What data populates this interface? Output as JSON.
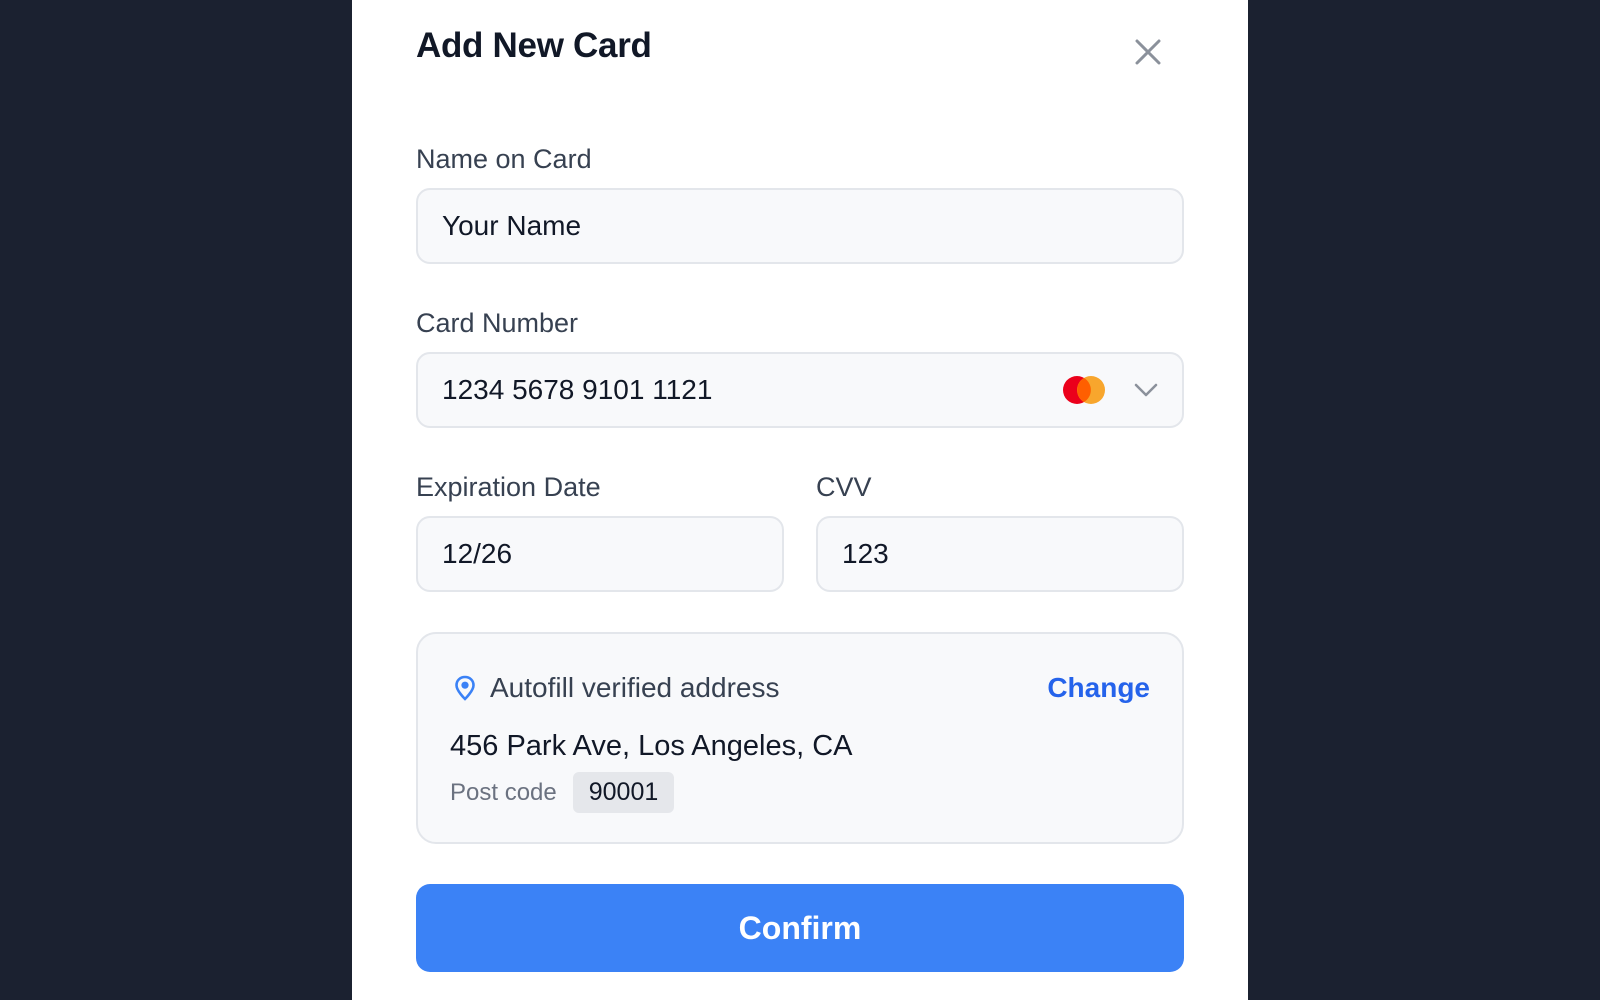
{
  "modal": {
    "title": "Add New Card",
    "close_icon": "close-icon"
  },
  "form": {
    "name": {
      "label": "Name on Card",
      "value": "Your Name"
    },
    "card_number": {
      "label": "Card Number",
      "value": "1234 5678 9101 1121",
      "brand_icon": "mastercard-icon",
      "dropdown_icon": "chevron-down-icon"
    },
    "expiration": {
      "label": "Expiration Date",
      "value": "12/26"
    },
    "cvv": {
      "label": "CVV",
      "value": "123"
    }
  },
  "address": {
    "icon": "location-pin-icon",
    "heading": "Autofill verified address",
    "change_label": "Change",
    "line": "456 Park Ave, Los Angeles, CA",
    "postcode_label": "Post code",
    "postcode": "90001"
  },
  "confirm_label": "Confirm",
  "colors": {
    "backdrop": "#1b2130",
    "accent": "#3b82f6",
    "link": "#2563eb",
    "mastercard_red": "#eb001b",
    "mastercard_orange": "#f79e1b"
  }
}
